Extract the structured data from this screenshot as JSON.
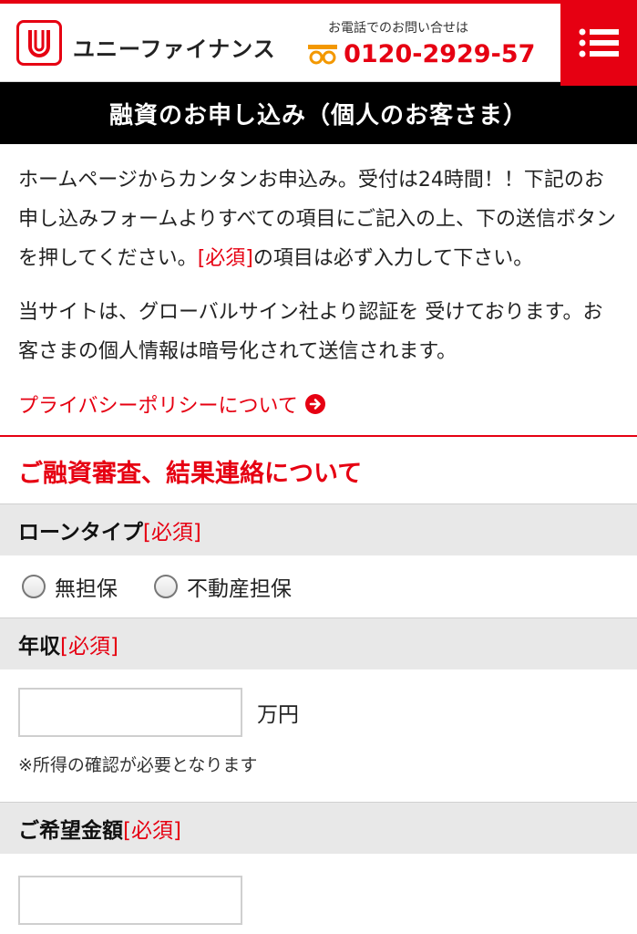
{
  "header": {
    "brand": "ユニーファイナンス",
    "tel_caption": "お電話でのお問い合せは",
    "tel_number": "0120-2929-57",
    "menu_icon": "hamburger-menu-icon",
    "accent": "#e60012"
  },
  "title_bar": "融資のお申し込み（個人のお客さま）",
  "intro": {
    "para1_a": "ホームページからカンタンお申込み。受付は24時間！！下記のお申し込みフォームよりすべての項目にご記入の上、下の送信ボタンを押してください。",
    "para1_req": "[必須]",
    "para1_b": "の項目は必ず入力して下さい。",
    "para2": "当サイトは、グローバルサイン社より認証を 受けております。お客さまの個人情報は暗号化されて送信されます。",
    "policy_link": "プライバシーポリシーについて"
  },
  "section_title": "ご融資審査、結果連絡について",
  "required_mark": "[必須]",
  "fields": {
    "loan_type": {
      "label": "ローンタイプ",
      "options": [
        "無担保",
        "不動産担保"
      ]
    },
    "income": {
      "label": "年収",
      "value": "",
      "unit": "万円",
      "note": "※所得の確認が必要となります"
    },
    "amount": {
      "label": "ご希望金額",
      "value": ""
    }
  }
}
